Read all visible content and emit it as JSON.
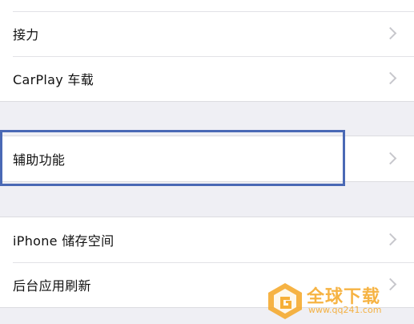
{
  "settings": {
    "group1": {
      "items": [
        {
          "label": "接力"
        },
        {
          "label": "CarPlay 车载"
        }
      ]
    },
    "group2": {
      "items": [
        {
          "label": "辅助功能"
        }
      ]
    },
    "group3": {
      "items": [
        {
          "label": "iPhone 储存空间"
        },
        {
          "label": "后台应用刷新"
        }
      ]
    }
  },
  "watermark": {
    "title": "全球下载",
    "url": "www.qq241.com"
  },
  "colors": {
    "highlight": "#4a69b5",
    "chevron": "#c7c7cc",
    "background": "#efeff4",
    "watermark": "#f5a623"
  },
  "icons": {
    "chevron": "chevron-right-icon",
    "watermark_logo": "watermark-logo-icon"
  }
}
